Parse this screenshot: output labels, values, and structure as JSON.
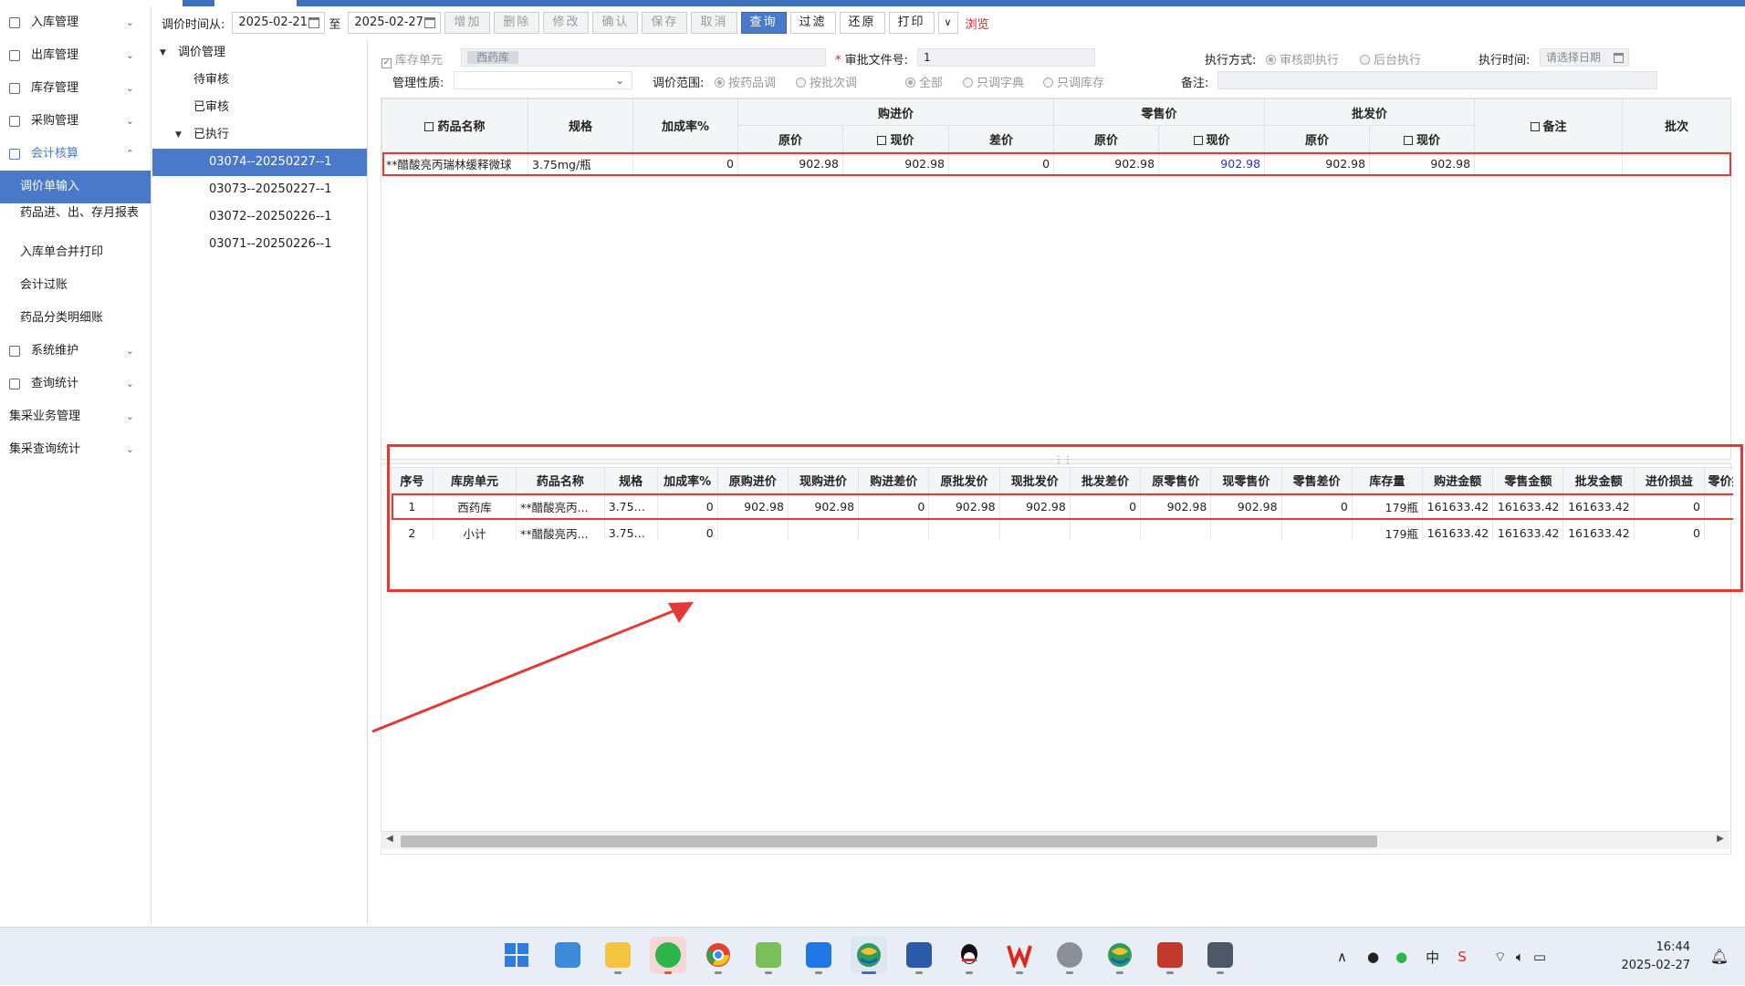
{
  "nav": {
    "groups": [
      {
        "label": "入库管理",
        "icon": "inbound-icon"
      },
      {
        "label": "出库管理",
        "icon": "outbound-icon"
      },
      {
        "label": "库存管理",
        "icon": "inventory-icon"
      },
      {
        "label": "采购管理",
        "icon": "purchase-icon"
      },
      {
        "label": "会计核算",
        "icon": "accounting-icon"
      }
    ],
    "sub_items": [
      "调价单输入",
      "药品进、出、存月报表",
      "入库单合并打印",
      "会计过账",
      "药品分类明细账"
    ],
    "groups_after": [
      {
        "label": "系统维护",
        "icon": "system-icon"
      },
      {
        "label": "查询统计",
        "icon": "query-icon"
      },
      {
        "label": "集采业务管理",
        "icon": ""
      },
      {
        "label": "集采查询统计",
        "icon": ""
      }
    ]
  },
  "toolbar": {
    "date_label": "调价时间从:",
    "date_from": "2025-02-21",
    "to_label": "至",
    "date_to": "2025-02-27",
    "buttons": [
      "增加",
      "删除",
      "修改",
      "确认",
      "保存",
      "取消",
      "查询",
      "过滤",
      "还原",
      "打印"
    ],
    "browse": "浏览"
  },
  "tree": {
    "root": "调价管理",
    "pending": "待审核",
    "approved": "已审核",
    "executed": "已执行",
    "docs": [
      "03074--20250227--1",
      "03073--20250227--1",
      "03072--20250226--1",
      "03071--20250226--1"
    ]
  },
  "form": {
    "storage_unit_label": "库存单元",
    "storage_unit_value": "西药库",
    "approval_doc_label": "审批文件号:",
    "approval_doc_value": "1",
    "exec_mode_label": "执行方式:",
    "exec_mode_immediate": "审核即执行",
    "exec_mode_background": "后台执行",
    "exec_time_label": "执行时间:",
    "exec_time_placeholder": "请选择日期",
    "mgmt_label": "管理性质:",
    "range_label": "调价范围:",
    "range_by_item": "按药品调",
    "range_by_batch": "按批次调",
    "scope_all": "全部",
    "scope_dict": "只调字典",
    "scope_stock": "只调库存",
    "remark_label": "备注:"
  },
  "upper_grid": {
    "headers": {
      "name": "药品名称",
      "spec": "规格",
      "markup": "加成率%",
      "purchase": "购进价",
      "retail": "零售价",
      "wholesale": "批发价",
      "original": "原价",
      "current": "现价",
      "diff": "差价",
      "remark": "备注",
      "batch": "批次"
    },
    "rows": [
      {
        "name": "**醋酸亮丙瑞林缓释微球",
        "spec": "3.75mg/瓶",
        "markup": "0",
        "pur_orig": "902.98",
        "pur_now": "902.98",
        "pur_diff": "0",
        "ret_orig": "902.98",
        "ret_now": "902.98",
        "whl_orig": "902.98",
        "whl_now": "902.98",
        "remark": "",
        "batch": ""
      }
    ]
  },
  "lower_grid": {
    "headers": [
      "序号",
      "库房单元",
      "药品名称",
      "规格",
      "加成率%",
      "原购进价",
      "现购进价",
      "购进差价",
      "原批发价",
      "现批发价",
      "批发差价",
      "原零售价",
      "现零售价",
      "零售差价",
      "库存量",
      "购进金额",
      "零售金额",
      "批发金额",
      "进价损益",
      "零价损益"
    ],
    "rows": [
      [
        "1",
        "西药库",
        "**醋酸亮丙...",
        "3.75m...",
        "0",
        "902.98",
        "902.98",
        "0",
        "902.98",
        "902.98",
        "0",
        "902.98",
        "902.98",
        "0",
        "179瓶",
        "161633.42",
        "161633.42",
        "161633.42",
        "0",
        ""
      ],
      [
        "2",
        "小计",
        "**醋酸亮丙...",
        "3.75m...",
        "0",
        "",
        "",
        "",
        "",
        "",
        "",
        "",
        "",
        "",
        "179瓶",
        "161633.42",
        "161633.42",
        "161633.42",
        "0",
        ""
      ]
    ]
  },
  "taskbar": {
    "apps": [
      "windows-start-icon",
      "photos-icon",
      "file-explorer-icon",
      "wechat-icon",
      "chrome-icon",
      "notepad-icon",
      "feishu-icon",
      "app-s-icon",
      "remote-desktop-icon",
      "qq-icon",
      "wps-icon",
      "media-icon",
      "app-s2-icon",
      "database-icon",
      "calculator-icon"
    ],
    "time": "16:44",
    "date": "2025-02-27",
    "ime": "中"
  },
  "colors": {
    "accent": "#4a79c9",
    "highlight": "#e53935"
  }
}
